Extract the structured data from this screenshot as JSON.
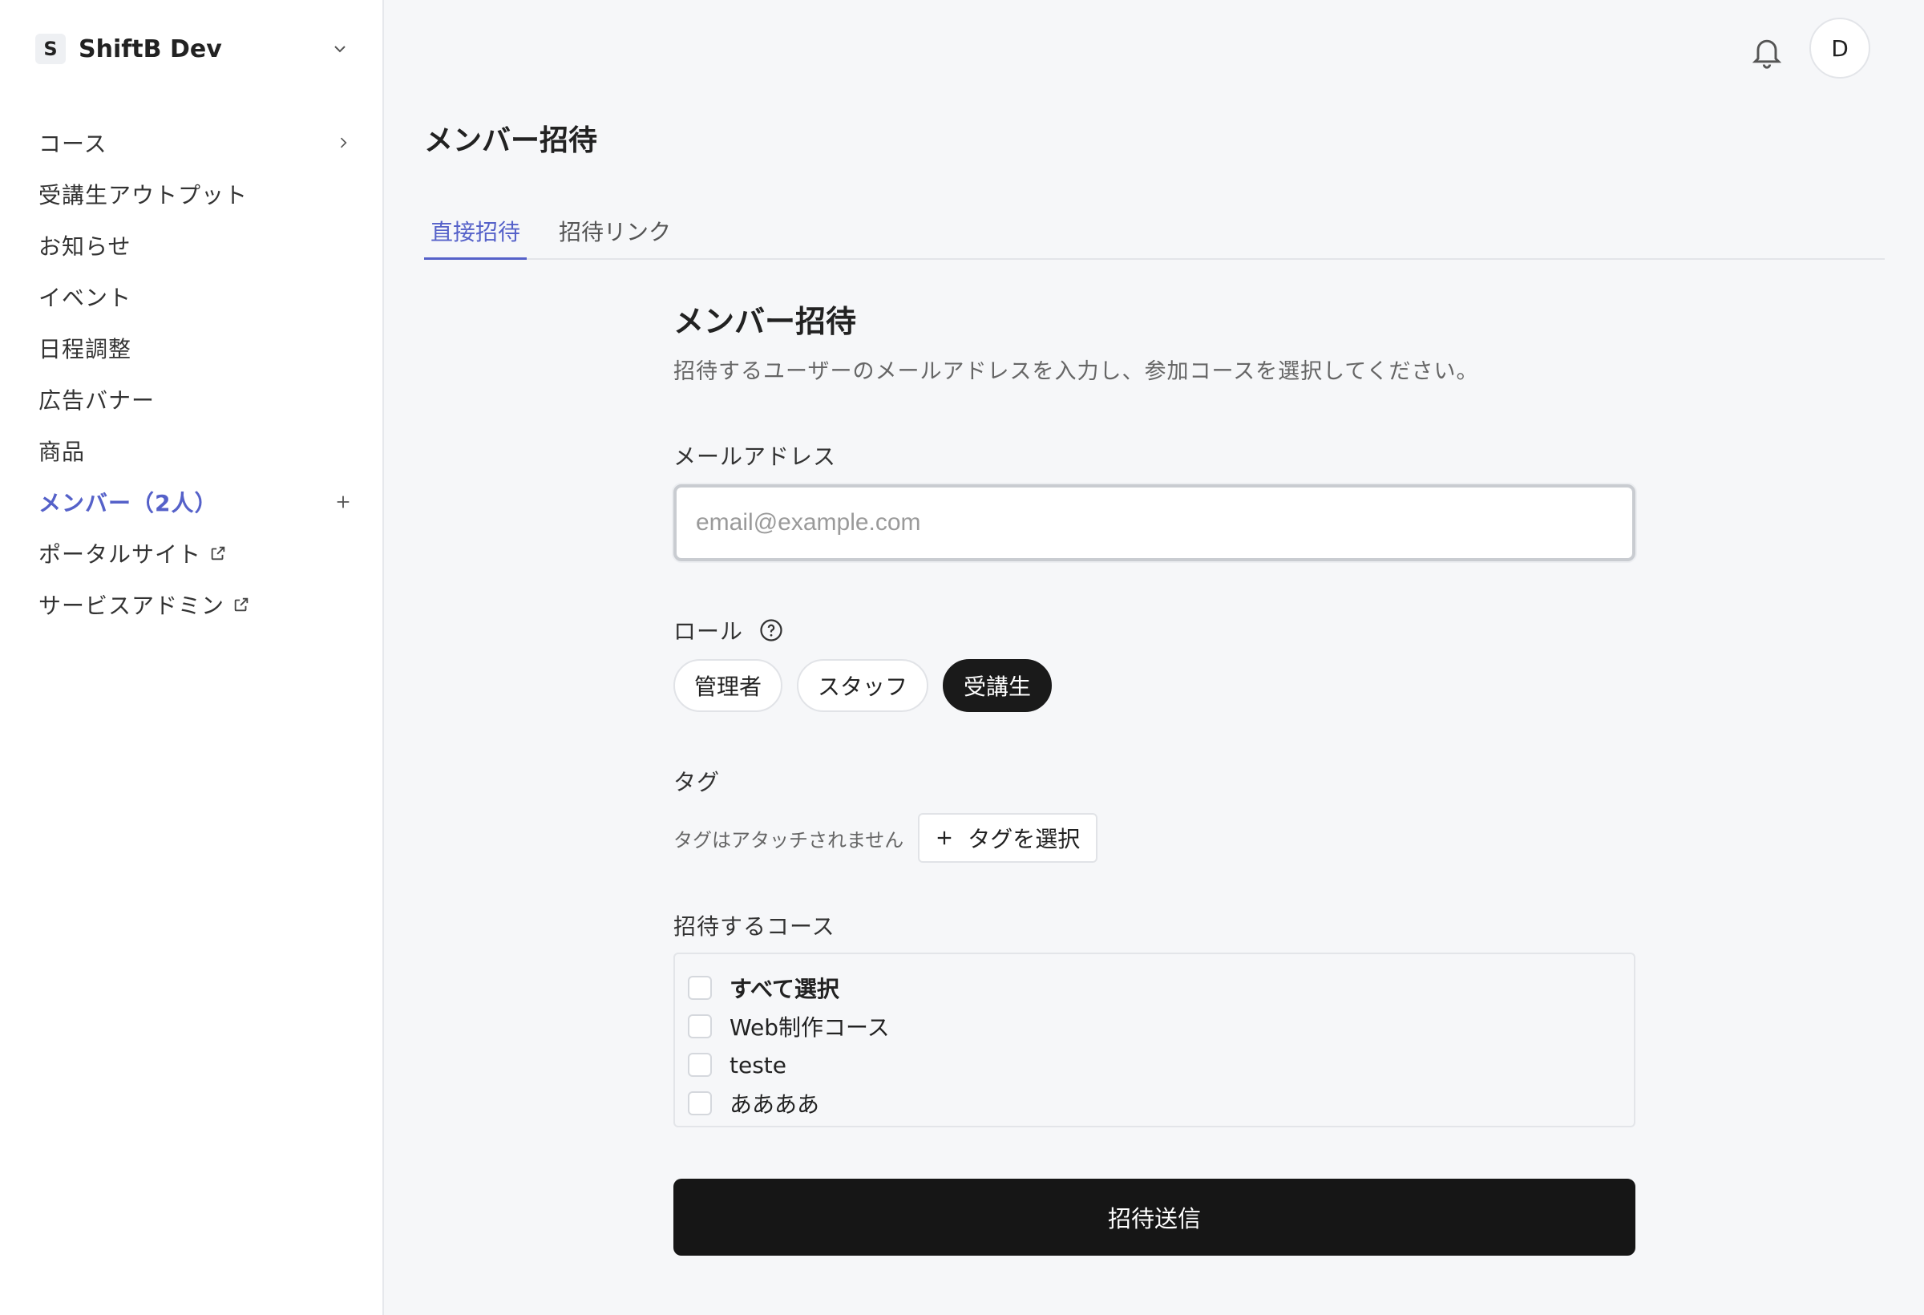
{
  "workspace": {
    "initial": "S",
    "name": "ShiftB Dev"
  },
  "sidebar": {
    "items": [
      {
        "label": "コース",
        "trail": "chevron-right"
      },
      {
        "label": "受講生アウトプット"
      },
      {
        "label": "お知らせ"
      },
      {
        "label": "イベント"
      },
      {
        "label": "日程調整"
      },
      {
        "label": "広告バナー"
      },
      {
        "label": "商品"
      },
      {
        "label": "メンバー（2人）",
        "active": true,
        "trail": "plus"
      },
      {
        "label": "ポータルサイト",
        "external": true
      },
      {
        "label": "サービスアドミン",
        "external": true
      }
    ]
  },
  "topbar": {
    "avatar_initial": "D"
  },
  "page": {
    "title": "メンバー招待",
    "tabs": [
      {
        "label": "直接招待",
        "active": true
      },
      {
        "label": "招待リンク"
      }
    ]
  },
  "form": {
    "title": "メンバー招待",
    "description": "招待するユーザーのメールアドレスを入力し、参加コースを選択してください。",
    "email_label": "メールアドレス",
    "email_placeholder": "email@example.com",
    "email_value": "",
    "role_label": "ロール",
    "roles": [
      {
        "label": "管理者",
        "selected": false
      },
      {
        "label": "スタッフ",
        "selected": false
      },
      {
        "label": "受講生",
        "selected": true
      }
    ],
    "tag_label": "タグ",
    "tag_empty": "タグはアタッチされません",
    "tag_button": "タグを選択",
    "course_label": "招待するコース",
    "courses": [
      {
        "label": "すべて選択",
        "checked": false
      },
      {
        "label": "Web制作コース",
        "checked": false
      },
      {
        "label": "teste",
        "checked": false
      },
      {
        "label": "ああああ",
        "checked": false
      }
    ],
    "submit": "招待送信"
  },
  "colors": {
    "accent": "#5561c9",
    "primary_button": "#161616",
    "background": "#f6f7f9"
  }
}
